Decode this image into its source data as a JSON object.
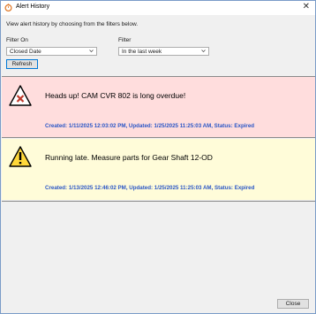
{
  "window": {
    "title": "Alert History"
  },
  "description": "View alert history by choosing from the filters below.",
  "filters": {
    "filter_on_label": "Filter On",
    "filter_on_value": "Closed Date",
    "filter_label": "Filter",
    "filter_value": "In the last week"
  },
  "buttons": {
    "refresh": "Refresh",
    "close": "Close"
  },
  "alerts": [
    {
      "severity": "error",
      "icon": "error-icon",
      "message": "Heads up! CAM CVR 802 is long overdue!",
      "meta": "Created: 1/11/2025 12:03:02 PM, Updated: 1/25/2025 11:25:03 AM, Status: Expired",
      "background": "#ffdddd"
    },
    {
      "severity": "warning",
      "icon": "warning-icon",
      "message": "Running late. Measure parts for Gear Shaft 12-OD",
      "meta": "Created: 1/13/2025 12:46:02 PM, Updated: 1/25/2025 11:25:03 AM, Status: Expired",
      "background": "#fffcd9"
    }
  ],
  "colors": {
    "meta_text": "#2a56c6",
    "error_bg": "#ffdddd",
    "warning_bg": "#fffcd9",
    "accent": "#0078d7"
  }
}
